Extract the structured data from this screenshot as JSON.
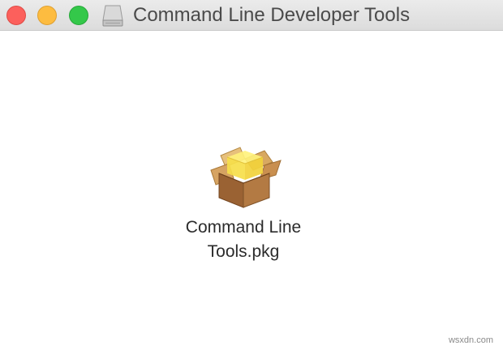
{
  "window": {
    "title": "Command Line Developer Tools",
    "title_icon": "disk-image-icon",
    "buttons": {
      "close": "close",
      "minimize": "minimize",
      "zoom": "zoom"
    },
    "colors": {
      "close": "#fc605c",
      "minimize": "#fdbc40",
      "zoom": "#34c84a"
    }
  },
  "content": {
    "items": [
      {
        "label": "Command Line Tools.pkg",
        "icon": "package-icon"
      }
    ]
  },
  "watermark": "wsxdn.com"
}
